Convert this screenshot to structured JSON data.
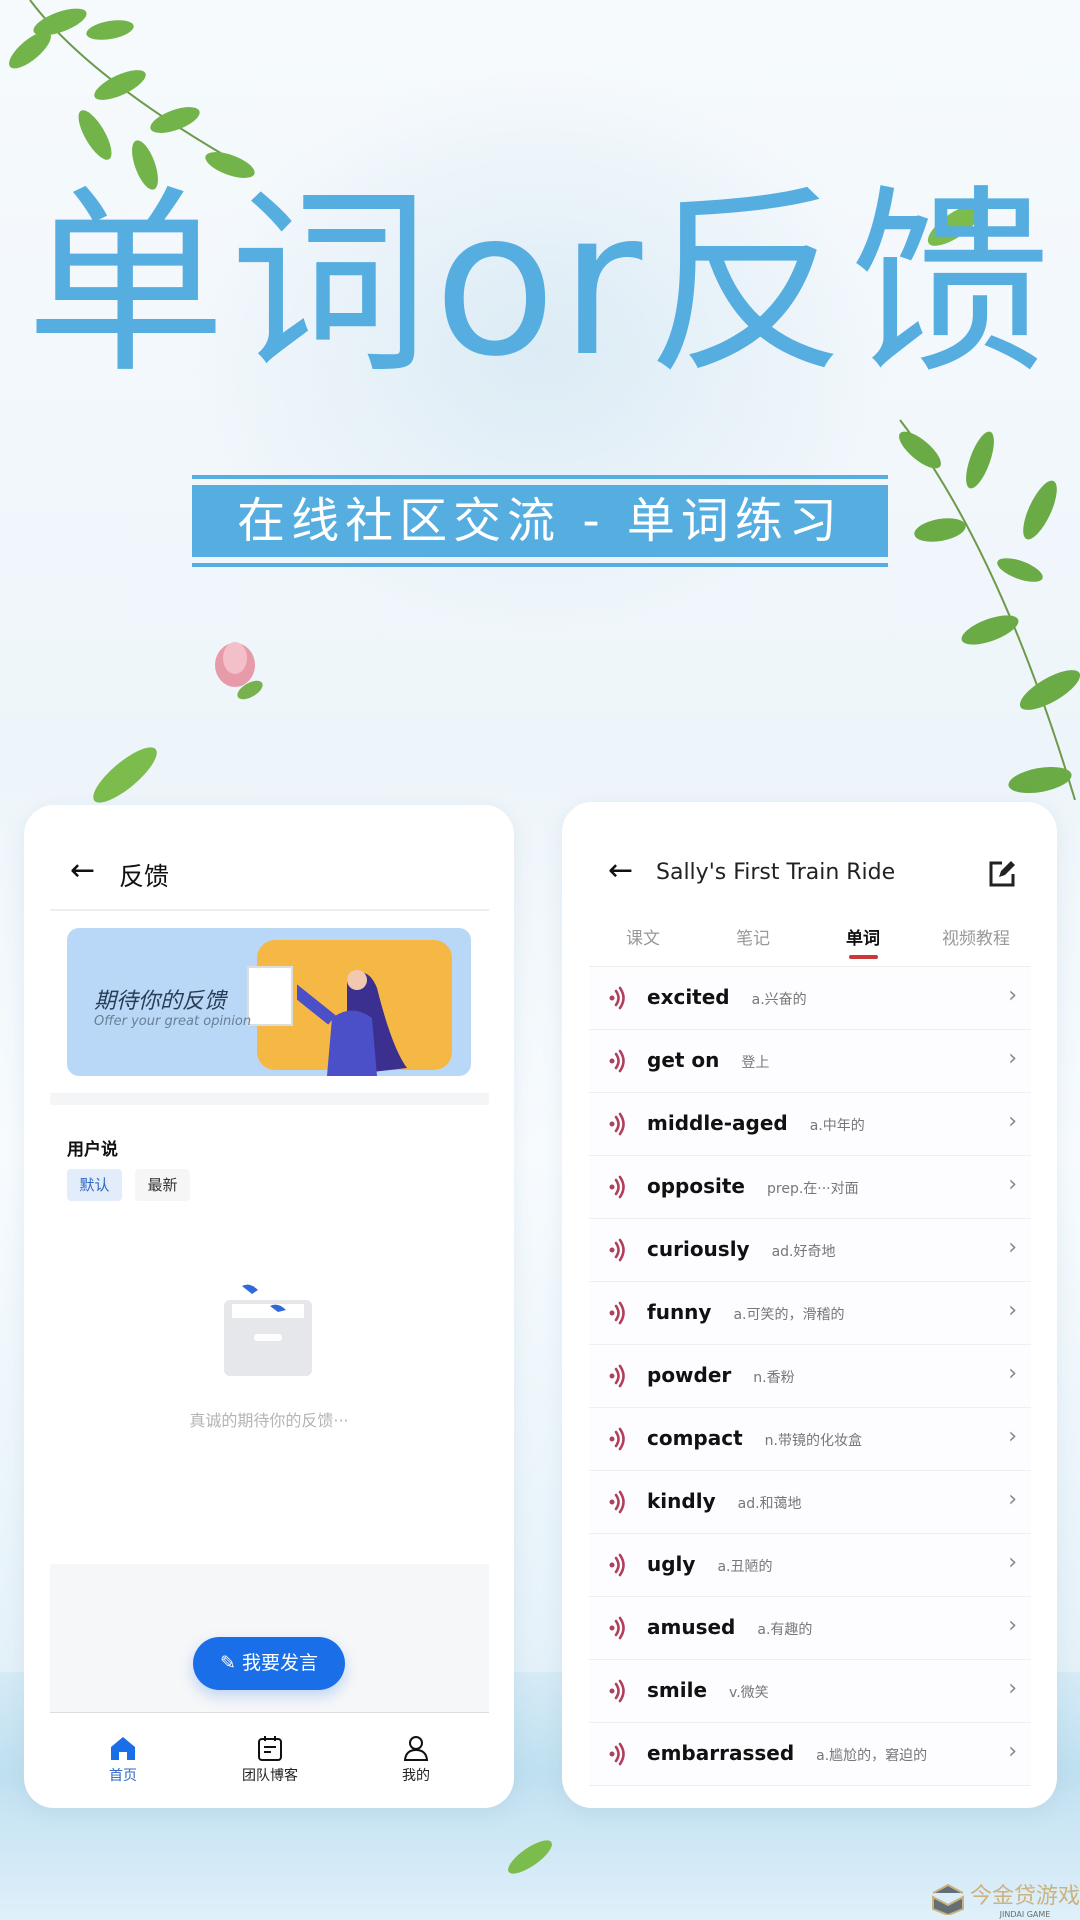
{
  "colors": {
    "accent": "#55ade0",
    "primary_button": "#1a6fe8",
    "speaker": "#b0405e",
    "tab_underline": "#c83a3a"
  },
  "hero": {
    "title": "单词or反馈",
    "subtitle": "在线社区交流 - 单词练习"
  },
  "feedback_screen": {
    "header": {
      "back_icon": "arrow-left-icon",
      "title": "反馈"
    },
    "banner": {
      "title": "期待你的反馈",
      "subtitle": "Offer your great opinion"
    },
    "section_title": "用户说",
    "filters": [
      {
        "label": "默认",
        "selected": true
      },
      {
        "label": "最新",
        "selected": false
      }
    ],
    "empty_text": "真诚的期待你的反馈···",
    "post_button": {
      "icon": "pencil-icon",
      "label": "我要发言"
    },
    "bottom_nav": [
      {
        "label": "首页",
        "icon": "home-icon",
        "active": true
      },
      {
        "label": "团队博客",
        "icon": "calendar-note-icon",
        "active": false
      },
      {
        "label": "我的",
        "icon": "user-icon",
        "active": false
      }
    ]
  },
  "words_screen": {
    "header": {
      "back_icon": "arrow-left-icon",
      "title": "Sally's First Train Ride",
      "edit_icon": "edit-icon"
    },
    "tabs": [
      {
        "label": "课文"
      },
      {
        "label": "笔记"
      },
      {
        "label": "单词",
        "active": true
      },
      {
        "label": "视频教程"
      }
    ],
    "words": [
      {
        "word": "excited",
        "meaning": "a.兴奋的"
      },
      {
        "word": "get on",
        "meaning": "登上"
      },
      {
        "word": "middle-aged",
        "meaning": "a.中年的"
      },
      {
        "word": "opposite",
        "meaning": "prep.在···对面"
      },
      {
        "word": "curiously",
        "meaning": "ad.好奇地"
      },
      {
        "word": "funny",
        "meaning": "a.可笑的，滑稽的"
      },
      {
        "word": "powder",
        "meaning": "n.香粉"
      },
      {
        "word": "compact",
        "meaning": "n.带镜的化妆盒"
      },
      {
        "word": "kindly",
        "meaning": "ad.和蔼地"
      },
      {
        "word": "ugly",
        "meaning": "a.丑陋的"
      },
      {
        "word": "amused",
        "meaning": "a.有趣的"
      },
      {
        "word": "smile",
        "meaning": "v.微笑"
      },
      {
        "word": "embarrassed",
        "meaning": "a.尴尬的，窘迫的"
      }
    ]
  },
  "watermark": {
    "name": "今金贷游戏",
    "sub": "JINDAI GAME"
  }
}
